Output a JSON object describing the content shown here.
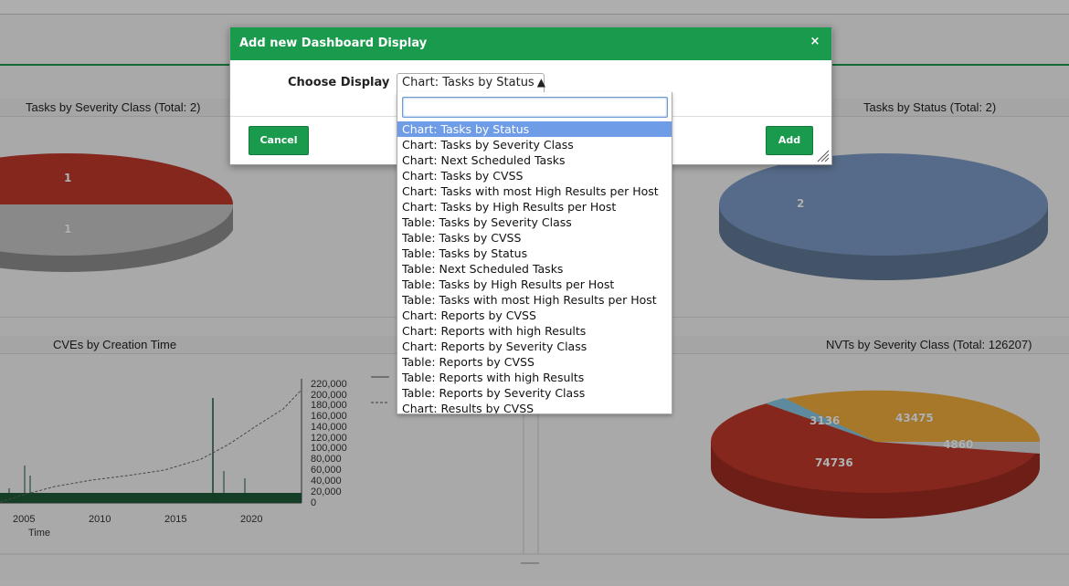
{
  "dashboard": {
    "panels": [
      {
        "title": "Tasks by Severity Class (Total: 2)"
      },
      {
        "title": "Tasks by Status (Total: 2)"
      },
      {
        "title": "CVEs by Creation Time"
      },
      {
        "title": "NVTs by Severity Class (Total: 126207)"
      }
    ],
    "pie_severity_labels": [
      "1",
      "1"
    ],
    "pie_status_labels": [
      "2"
    ],
    "pie_nvt_labels": [
      "3136",
      "43475",
      "4860",
      "74736"
    ],
    "cve_x_ticks": [
      "2005",
      "2010",
      "2015",
      "2020"
    ],
    "cve_x_label": "Time",
    "cve_y_ticks": [
      "220,000",
      "200,000",
      "180,000",
      "160,000",
      "140,000",
      "120,000",
      "100,000",
      "80,000",
      "60,000",
      "40,000",
      "20,000",
      "0"
    ]
  },
  "modal": {
    "title": "Add new Dashboard Display",
    "close_icon": "×",
    "choose_label": "Choose Display",
    "selected_value": "Chart: Tasks by Status",
    "select_arrow": "▲",
    "cancel_label": "Cancel",
    "add_label": "Add"
  },
  "dropdown": {
    "search_value": "",
    "options": [
      "Chart: Tasks by Status",
      "Chart: Tasks by Severity Class",
      "Chart: Next Scheduled Tasks",
      "Chart: Tasks by CVSS",
      "Chart: Tasks with most High Results per Host",
      "Chart: Tasks by High Results per Host",
      "Table: Tasks by Severity Class",
      "Table: Tasks by CVSS",
      "Table: Tasks by Status",
      "Table: Next Scheduled Tasks",
      "Table: Tasks by High Results per Host",
      "Table: Tasks with most High Results per Host",
      "Chart: Reports by CVSS",
      "Chart: Reports with high Results",
      "Chart: Reports by Severity Class",
      "Table: Reports by CVSS",
      "Table: Reports with high Results",
      "Table: Reports by Severity Class",
      "Chart: Results by CVSS"
    ],
    "selected_index": 0
  },
  "colors": {
    "brand_green": "#1a9a4c",
    "selected_option": "#6f9ce6",
    "severity_high": "#c0392b",
    "status_blue": "#7c9ac4",
    "nvt_orange": "#f0ad3c"
  }
}
